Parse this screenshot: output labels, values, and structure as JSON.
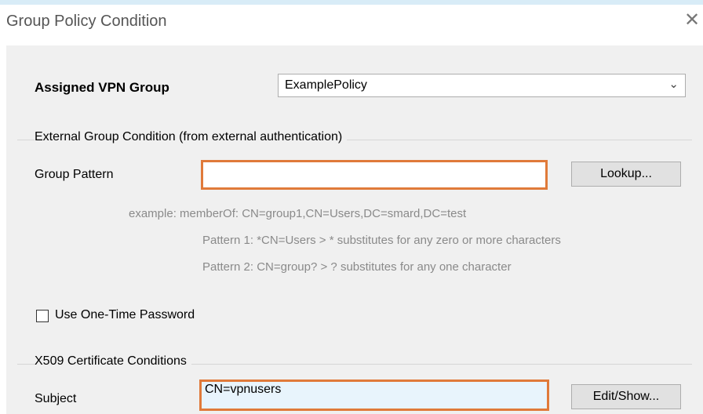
{
  "window": {
    "title": "Group Policy Condition",
    "close_icon": "close-icon"
  },
  "assigned_vpn_group": {
    "label": "Assigned VPN Group",
    "selected": "ExamplePolicy",
    "dropdown_icon": "chevron-down-icon"
  },
  "external_group": {
    "legend": "External Group Condition (from external authentication)",
    "group_pattern_label": "Group Pattern",
    "group_pattern_value": "",
    "lookup_button": "Lookup...",
    "example_line": "example:  memberOf: CN=group1,CN=Users,DC=smard,DC=test",
    "pattern1_line": "Pattern 1: *CN=Users   > * substitutes for any zero or more characters",
    "pattern2_line": "Pattern 2: CN=group?  > ? substitutes for any one character"
  },
  "otp": {
    "label": "Use One-Time Password",
    "checked": false
  },
  "x509": {
    "legend": "X509 Certificate Conditions",
    "subject_label": "Subject",
    "subject_value": "CN=vpnusers",
    "edit_button": "Edit/Show..."
  },
  "colors": {
    "accent_border": "#e07a3a",
    "input_highlight": "#e8f4fc",
    "title_strip": "#d8ecf7"
  }
}
